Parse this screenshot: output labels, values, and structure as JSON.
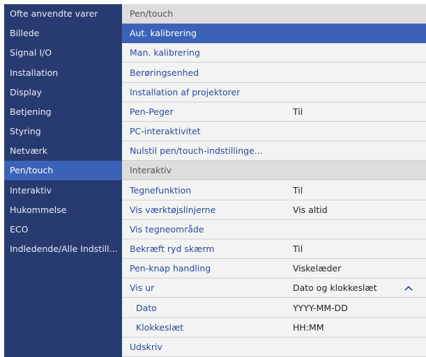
{
  "sidebar": {
    "items": [
      {
        "label": "Ofte anvendte varer"
      },
      {
        "label": "Billede"
      },
      {
        "label": "Signal I/O"
      },
      {
        "label": "Installation"
      },
      {
        "label": "Display"
      },
      {
        "label": "Betjening"
      },
      {
        "label": "Styring"
      },
      {
        "label": "Netværk"
      },
      {
        "label": "Pen/touch"
      },
      {
        "label": "Interaktiv"
      },
      {
        "label": "Hukommelse"
      },
      {
        "label": "ECO"
      },
      {
        "label": "Indledende/Alle Indstill..."
      }
    ],
    "selected": "Pen/touch"
  },
  "content": {
    "pen_section": {
      "header": "Pen/touch",
      "rows": [
        {
          "label": "Aut. kalibrering",
          "value": ""
        },
        {
          "label": "Man. kalibrering",
          "value": ""
        },
        {
          "label": "Berøringsenhed",
          "value": ""
        },
        {
          "label": "Installation af projektorer",
          "value": ""
        },
        {
          "label": "Pen-Peger",
          "value": "Til"
        },
        {
          "label": "PC-interaktivitet",
          "value": ""
        },
        {
          "label": "Nulstil pen/touch-indstillinge...",
          "value": ""
        }
      ]
    },
    "interactive_section": {
      "header": "Interaktiv",
      "rows": [
        {
          "label": "Tegnefunktion",
          "value": "Til"
        },
        {
          "label": "Vis værktøjslinjerne",
          "value": "Vis altid"
        },
        {
          "label": "Vis tegneområde",
          "value": ""
        },
        {
          "label": "Bekræft ryd skærm",
          "value": "Til"
        },
        {
          "label": "Pen-knap handling",
          "value": "Viskelæder"
        },
        {
          "label": "Vis ur",
          "value": "Dato og klokkeslæt"
        },
        {
          "label": "Dato",
          "value": "YYYY-MM-DD"
        },
        {
          "label": "Klokkeslæt",
          "value": "HH:MM"
        },
        {
          "label": "Udskriv",
          "value": ""
        }
      ]
    },
    "selected_row": "Aut. kalibrering",
    "expanded_row": "Vis ur"
  },
  "colors": {
    "sidebar_bg": "#283b70",
    "highlight": "#3c62b8",
    "label_text": "#2a4a9c",
    "content_bg": "#f3f3f3",
    "header_bg": "#dddddd"
  },
  "icons": {
    "expand": "chevron-up-icon"
  }
}
